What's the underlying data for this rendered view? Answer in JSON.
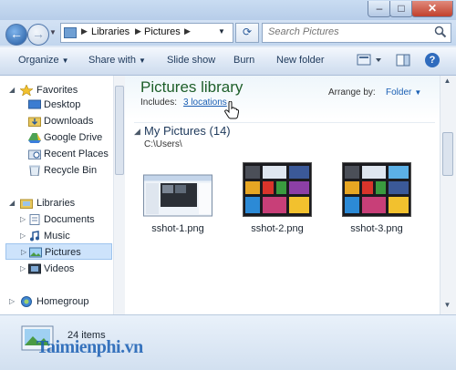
{
  "window": {
    "min_label": "–",
    "max_label": "□",
    "close_label": "✕"
  },
  "address": {
    "crumbs": [
      "Libraries",
      "Pictures"
    ],
    "back_label": "←",
    "forward_label": "→",
    "refresh_label": "⟳"
  },
  "search": {
    "placeholder": "Search Pictures"
  },
  "toolbar": {
    "organize": "Organize",
    "share_with": "Share with",
    "slide_show": "Slide show",
    "burn": "Burn",
    "new_folder": "New folder",
    "help": "?"
  },
  "nav": {
    "favorites": "Favorites",
    "desktop": "Desktop",
    "downloads": "Downloads",
    "google_drive": "Google Drive",
    "recent_places": "Recent Places",
    "recycle_bin": "Recycle Bin",
    "libraries": "Libraries",
    "documents": "Documents",
    "music": "Music",
    "pictures": "Pictures",
    "videos": "Videos",
    "homegroup": "Homegroup"
  },
  "library": {
    "title": "Pictures library",
    "includes_label": "Includes:",
    "locations_link": "3 locations",
    "arrange_label": "Arrange by:",
    "arrange_value": "Folder"
  },
  "group": {
    "title": "My Pictures (14)",
    "path": "C:\\Users\\"
  },
  "files": [
    {
      "name": "sshot-1.png"
    },
    {
      "name": "sshot-2.png"
    },
    {
      "name": "sshot-3.png"
    }
  ],
  "status": {
    "item_count": "24 items"
  },
  "watermark": "Taimienphi.vn",
  "colors": {
    "accent": "#1a5fb4",
    "title_green": "#1e5f2a",
    "selection": "#cde3fb"
  }
}
